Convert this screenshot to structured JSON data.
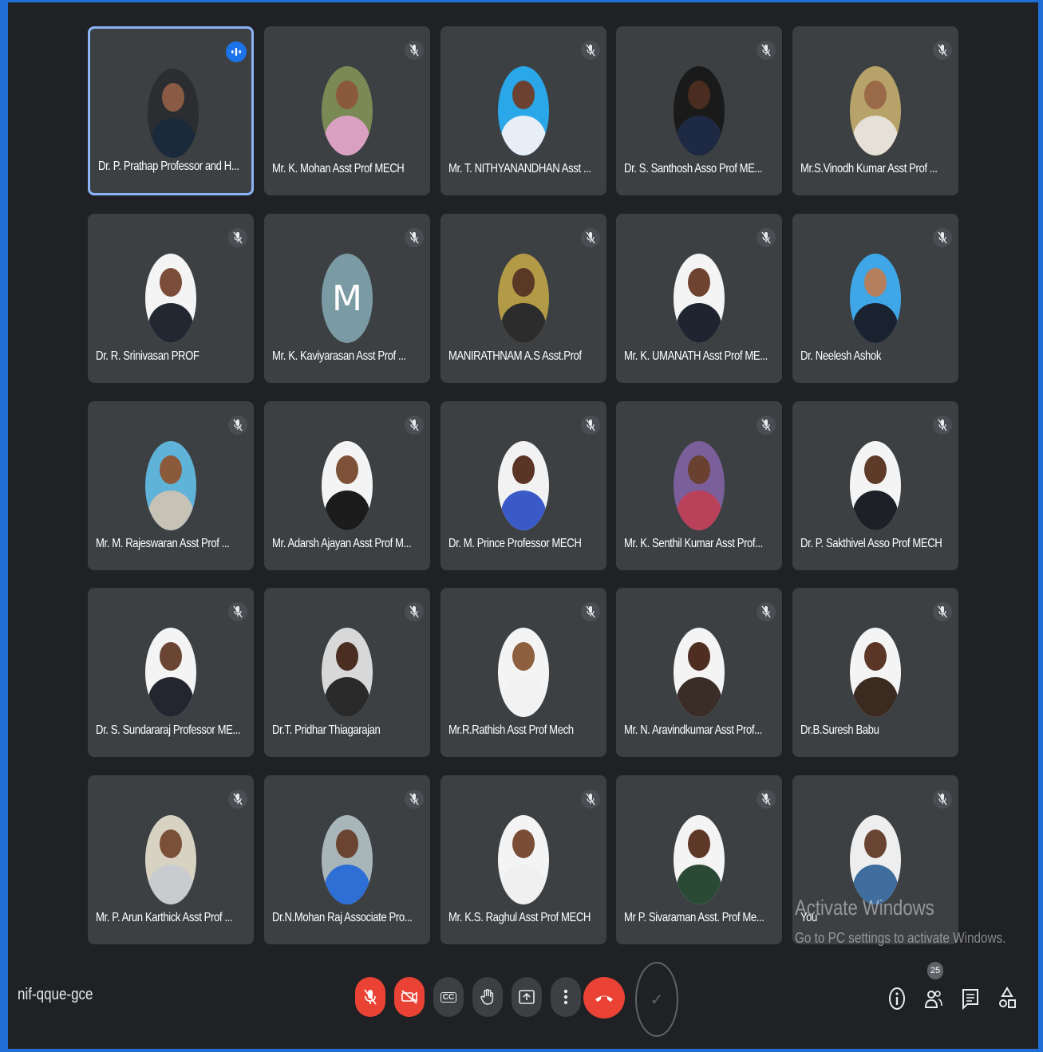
{
  "meeting": {
    "code": "nif-qque-gce",
    "participant_count": "25"
  },
  "watermark": {
    "line1": "Activate Windows",
    "line2": "Go to PC settings to activate Windows."
  },
  "self_label": "You",
  "tiles": [
    {
      "name": "Dr. P. Prathap Professor and H...",
      "speaking": true,
      "skin": "#8a5a44",
      "shirt": "#1b2a3a",
      "bg": "#2b2d31"
    },
    {
      "name": "Mr. K. Mohan Asst Prof MECH",
      "skin": "#8b5a3c",
      "shirt": "#d9a0c2",
      "bg": "#7a8a55"
    },
    {
      "name": "Mr. T. NITHYANANDHAN Asst ...",
      "skin": "#6b4232",
      "shirt": "#e8eef6",
      "bg": "#29a7e8"
    },
    {
      "name": "Dr. S. Santhosh Asso Prof ME...",
      "skin": "#4a2c20",
      "shirt": "#1e2a44",
      "bg": "#1a1a1a"
    },
    {
      "name": "Mr.S.Vinodh Kumar Asst Prof ...",
      "skin": "#9a6a48",
      "shirt": "#e6e1d8",
      "bg": "#b7a36a"
    },
    {
      "name": "Dr. R. Srinivasan PROF",
      "skin": "#7a4e38",
      "shirt": "#222831",
      "bg": "#f4f4f4"
    },
    {
      "name": "Mr. K. Kaviyarasan Asst Prof ...",
      "letter": "M"
    },
    {
      "name": "MANIRATHNAM A.S Asst.Prof",
      "skin": "#5a3826",
      "shirt": "#2c2c2c",
      "bg": "#b39a47"
    },
    {
      "name": "Mr. K. UMANATH Asst Prof ME...",
      "skin": "#6e4330",
      "shirt": "#1e2530",
      "bg": "#f4f4f4"
    },
    {
      "name": "Dr. Neelesh Ashok",
      "skin": "#b57e5c",
      "shirt": "#1a2230",
      "bg": "#3fa7e8"
    },
    {
      "name": "Mr. M. Rajeswaran Asst Prof ...",
      "skin": "#8a5a3a",
      "shirt": "#c6c2b6",
      "bg": "#5fb3d8"
    },
    {
      "name": "Mr. Adarsh Ajayan Asst Prof M...",
      "skin": "#7e5238",
      "shirt": "#1c1c1c",
      "bg": "#f4f4f4"
    },
    {
      "name": "Dr. M. Prince Professor MECH",
      "skin": "#5a3424",
      "shirt": "#3a5ac8",
      "bg": "#f2f2f2"
    },
    {
      "name": "Mr. K. Senthil Kumar Asst Prof...",
      "skin": "#6a4030",
      "shirt": "#b9425a",
      "bg": "#7a5f9a"
    },
    {
      "name": "Dr. P. Sakthivel Asso Prof MECH",
      "skin": "#5e3a28",
      "shirt": "#1e2028",
      "bg": "#f4f4f4"
    },
    {
      "name": "Dr. S. Sundararaj Professor ME...",
      "skin": "#6a4534",
      "shirt": "#23262e",
      "bg": "#f4f4f4"
    },
    {
      "name": "Dr.T. Pridhar Thiagarajan",
      "skin": "#4a2e22",
      "shirt": "#2a2a2a",
      "bg": "#d8d8d8"
    },
    {
      "name": "Mr.R.Rathish Asst Prof Mech",
      "skin": "#8e6040",
      "shirt": "#f2f2f2",
      "bg": "#f4f4f4"
    },
    {
      "name": "Mr. N. Aravindkumar Asst Prof...",
      "skin": "#4e2e20",
      "shirt": "#3a2c26",
      "bg": "#f4f4f4"
    },
    {
      "name": "Dr.B.Suresh Babu",
      "skin": "#5a3626",
      "shirt": "#3a2a20",
      "bg": "#f4f4f4"
    },
    {
      "name": "Mr. P. Arun Karthick Asst Prof ...",
      "skin": "#7a5038",
      "shirt": "#c8cccf",
      "bg": "#d8d2c2"
    },
    {
      "name": "Dr.N.Mohan Raj Associate Pro...",
      "skin": "#6a4430",
      "shirt": "#2e6fd6",
      "bg": "#a8b6ba"
    },
    {
      "name": "Mr. K.S. Raghul Asst Prof MECH",
      "skin": "#7a4e36",
      "shirt": "#f0f0f0",
      "bg": "#f4f4f4"
    },
    {
      "name": "Mr P. Sivaraman Asst. Prof Me...",
      "skin": "#5e3826",
      "shirt": "#2a4a36",
      "bg": "#f4f4f4"
    },
    {
      "name": "",
      "self": true,
      "skin": "#6a4432",
      "shirt": "#3f6d9e",
      "bg": "#eeeeee"
    }
  ],
  "controls": {
    "mic": "mic-off-icon",
    "camera": "camera-off-icon",
    "captions": "CC",
    "hand": "raise-hand-icon",
    "present": "present-icon",
    "more": "more-options-icon",
    "end": "end-call-icon"
  }
}
